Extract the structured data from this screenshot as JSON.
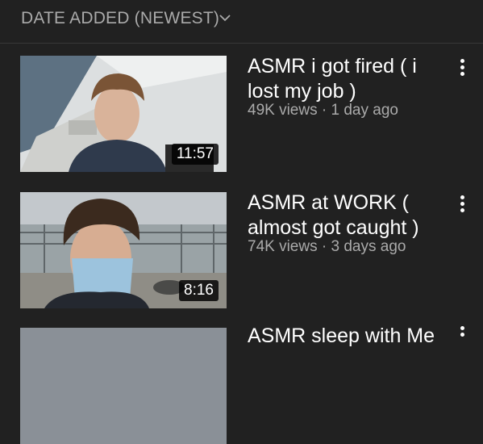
{
  "sort": {
    "label": "DATE ADDED (NEWEST)",
    "icon": "chevron-down-icon"
  },
  "videos": [
    {
      "title": "ASMR i got fired ( i lost my job )",
      "views": "49K views",
      "separator": "·",
      "age": "1 day ago",
      "duration": "11:57",
      "more_icon": "more-vert-icon"
    },
    {
      "title": "ASMR at WORK ( almost got caught )",
      "views": "74K views",
      "separator": "·",
      "age": "3 days ago",
      "duration": "8:16",
      "more_icon": "more-vert-icon"
    }
  ],
  "partial_video": {
    "title_fragment": "ASMR sleep with Me"
  },
  "colors": {
    "background": "#212121",
    "secondary_text": "#aaaaaa",
    "primary_text": "#ffffff"
  }
}
